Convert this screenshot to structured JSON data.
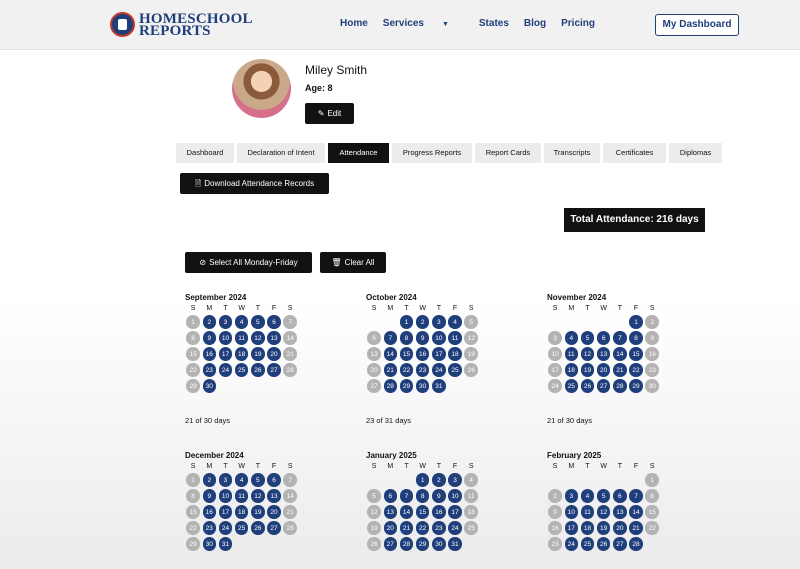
{
  "header": {
    "logo": {
      "line1": "HOMESCHOOL",
      "line2": "REPORTS"
    },
    "nav": [
      {
        "label": "Home"
      },
      {
        "label": "Services",
        "dropdown": true
      },
      {
        "label": "States"
      },
      {
        "label": "Blog"
      },
      {
        "label": "Pricing"
      }
    ],
    "dashboard_button": "My Dashboard"
  },
  "student": {
    "name": "Miley Smith",
    "age": "Age: 8",
    "edit_label": "Edit"
  },
  "tabs": [
    {
      "label": "Dashboard",
      "active": false
    },
    {
      "label": "Declaration of Intent",
      "active": false
    },
    {
      "label": "Attendance",
      "active": true
    },
    {
      "label": "Progress Reports",
      "active": false
    },
    {
      "label": "Report Cards",
      "active": false
    },
    {
      "label": "Transcripts",
      "active": false
    },
    {
      "label": "Certificates",
      "active": false
    },
    {
      "label": "Diplomas",
      "active": false
    }
  ],
  "actions": {
    "download": "Download Attendance Records",
    "select_all": "Select All Monday-Friday",
    "clear_all": "Clear All"
  },
  "total_attendance": "Total Attendance: 216 days",
  "weekdays": [
    "S",
    "M",
    "T",
    "W",
    "T",
    "F",
    "S"
  ],
  "colors": {
    "selected": "#1f3e7c",
    "unselected": "#b3b3b3"
  },
  "months": [
    {
      "title": "September 2024",
      "start": 0,
      "days": 30,
      "count": "21 of 30 days"
    },
    {
      "title": "October 2024",
      "start": 2,
      "days": 31,
      "count": "23 of 31 days"
    },
    {
      "title": "November 2024",
      "start": 5,
      "days": 30,
      "count": "21 of 30 days"
    },
    {
      "title": "December 2024",
      "start": 0,
      "days": 31,
      "count": ""
    },
    {
      "title": "January 2025",
      "start": 3,
      "days": 31,
      "count": ""
    },
    {
      "title": "February 2025",
      "start": 6,
      "days": 28,
      "count": ""
    }
  ]
}
